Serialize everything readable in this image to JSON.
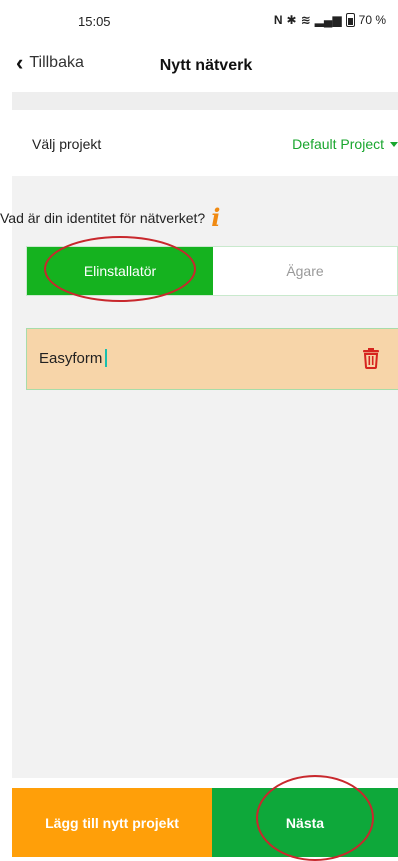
{
  "status_bar": {
    "time": "15:05",
    "battery": "70 %",
    "icons": [
      "nfc-icon",
      "bluetooth-icon",
      "wifi-icon",
      "signal-icon",
      "battery-icon"
    ]
  },
  "nav": {
    "back_label": "Tillbaka",
    "title": "Nytt nätverk"
  },
  "project": {
    "label": "Välj projekt",
    "value": "Default Project"
  },
  "identity": {
    "question": "Vad är din identitet för nätverket?",
    "options": [
      "Elinstallatör",
      "Ägare"
    ],
    "selected": "Elinstallatör"
  },
  "network": {
    "name": "Easyform"
  },
  "actions": {
    "add_project": "Lägg till nytt projekt",
    "next": "Nästa"
  },
  "colors": {
    "green": "#15b21f",
    "orange": "#ff9f09",
    "card": "#f7d5a9",
    "annotation": "#c8282d"
  }
}
